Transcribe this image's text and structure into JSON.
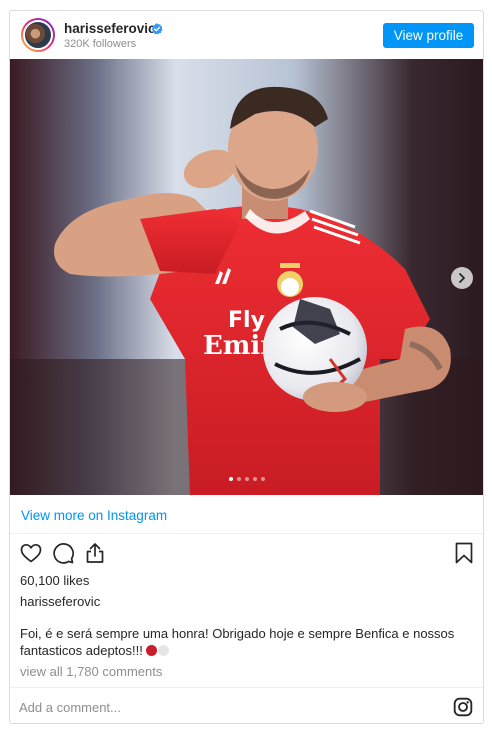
{
  "post": {
    "username": "harisseferovic",
    "followers": "320K followers",
    "view_profile_label": "View profile",
    "view_more_label": "View more on Instagram",
    "likes": "60,100 likes",
    "caption_author": "harisseferovic",
    "caption_text": "Foi, é e será sempre uma honra! Obrigado hoje e sempre Benfica e nossos fantasticos adeptos!!!",
    "comments_link": "view all 1,780 comments",
    "comment_placeholder": "Add a comment...",
    "carousel": {
      "count": 5,
      "active_index": 0
    },
    "icons": {
      "verified": "verified-badge-icon",
      "like": "heart-icon",
      "comment": "comment-bubble-icon",
      "share": "share-icon",
      "save": "bookmark-icon",
      "next": "chevron-right-icon",
      "brand": "instagram-icon"
    },
    "colors": {
      "accent": "#0095f6",
      "jersey": "#e8282b",
      "text": "#262626",
      "muted": "#8e8e8e"
    }
  }
}
